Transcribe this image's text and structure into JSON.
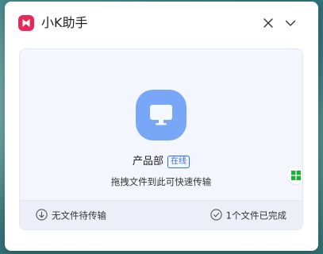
{
  "app": {
    "title": "小K助手",
    "logo_icon": "ks-logo-icon",
    "brand_color": "#e8285a"
  },
  "titlebar": {
    "close_icon": "close-icon",
    "collapse_icon": "chevron-down-icon"
  },
  "device": {
    "name": "产品部",
    "status": "在线",
    "avatar_icon": "monitor-icon",
    "avatar_color": "#79a7f7",
    "os_icon": "windows-icon",
    "os_color": "#18b135"
  },
  "drop_hint": "拖拽文件到此可快速传输",
  "footer": {
    "pending_label": "无文件待传输",
    "pending_icon": "arrow-down-circle-icon",
    "completed_label": "1个文件已完成",
    "completed_icon": "check-circle-icon"
  },
  "colors": {
    "accent": "#2f6ff0",
    "panel_bg": "#f4f6fd"
  }
}
